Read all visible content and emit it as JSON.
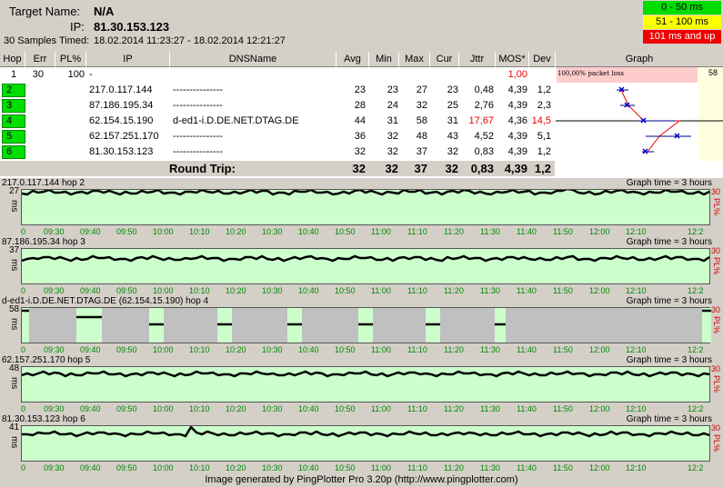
{
  "header": {
    "target_label": "Target Name:",
    "target_value": "N/A",
    "ip_label": "IP:",
    "ip_value": "81.30.153.123",
    "samples_label": "30 Samples Timed:",
    "samples_value": "18.02.2014 11:23:27 - 18.02.2014 12:21:27"
  },
  "legend": [
    {
      "label": "0 - 50 ms",
      "color": "#00dd00",
      "text_color": "#000000"
    },
    {
      "label": "51 - 100 ms",
      "color": "#ffff00",
      "text_color": "#000000"
    },
    {
      "label": "101 ms and up",
      "color": "#ee0000",
      "text_color": "#ffffff"
    }
  ],
  "columns": [
    "Hop",
    "Err",
    "PL%",
    "IP",
    "DNSName",
    "Avg",
    "Min",
    "Max",
    "Cur",
    "Jttr",
    "MOS*",
    "Dev",
    "Graph"
  ],
  "rows": [
    {
      "hop": "1",
      "err": "30",
      "pl": "100",
      "ip": "-",
      "dns": "",
      "avg": "",
      "min": "",
      "max": "",
      "cur": "",
      "jttr": "",
      "mos": "1,00",
      "dev": ""
    },
    {
      "hop": "2",
      "err": "",
      "pl": "",
      "ip": "217.0.117.144",
      "dns": "---------------",
      "avg": "23",
      "min": "23",
      "max": "27",
      "cur": "23",
      "jttr": "0,48",
      "mos": "4,39",
      "dev": "1,2"
    },
    {
      "hop": "3",
      "err": "",
      "pl": "",
      "ip": "87.186.195.34",
      "dns": "---------------",
      "avg": "28",
      "min": "24",
      "max": "32",
      "cur": "25",
      "jttr": "2,76",
      "mos": "4,39",
      "dev": "2,3"
    },
    {
      "hop": "4",
      "err": "",
      "pl": "",
      "ip": "62.154.15.190",
      "dns": "d-ed1-i.D.DE.NET.DTAG.DE",
      "avg": "44",
      "min": "31",
      "max": "58",
      "cur": "31",
      "jttr": "17,67",
      "mos": "4,36",
      "dev": "14,5"
    },
    {
      "hop": "5",
      "err": "",
      "pl": "",
      "ip": "62.157.251.170",
      "dns": "---------------",
      "avg": "36",
      "min": "32",
      "max": "48",
      "cur": "43",
      "jttr": "4,52",
      "mos": "4,39",
      "dev": "5,1"
    },
    {
      "hop": "6",
      "err": "",
      "pl": "",
      "ip": "81.30.153.123",
      "dns": "---------------",
      "avg": "32",
      "min": "32",
      "max": "37",
      "cur": "32",
      "jttr": "0,83",
      "mos": "4,39",
      "dev": "1,2"
    }
  ],
  "round_trip": {
    "label": "Round Trip:",
    "avg": "32",
    "min": "32",
    "max": "37",
    "cur": "32",
    "jttr": "0,83",
    "mos": "4,39",
    "dev": "1,2"
  },
  "graph_header": {
    "pl_label": "100,00% packet loss",
    "scale_max": "58"
  },
  "graphs": [
    {
      "title": "217.0.117.144 hop 2",
      "time": "Graph time = 3 hours",
      "ymax": "27",
      "ms": "ms",
      "pl_top": "30",
      "pl_label": "PL%"
    },
    {
      "title": "87.186.195.34 hop 3",
      "time": "Graph time = 3 hours",
      "ymax": "37",
      "ms": "ms",
      "pl_top": "30",
      "pl_label": "PL%"
    },
    {
      "title": "d-ed1-i.D.DE.NET.DTAG.DE (62.154.15.190) hop 4",
      "time": "Graph time = 3 hours",
      "ymax": "58",
      "ms": "ms",
      "pl_top": "30",
      "pl_label": "PL%"
    },
    {
      "title": "62.157.251.170 hop 5",
      "time": "Graph time = 3 hours",
      "ymax": "48",
      "ms": "ms",
      "pl_top": "30",
      "pl_label": "PL%"
    },
    {
      "title": "81.30.153.123 hop 6",
      "time": "Graph time = 3 hours",
      "ymax": "41",
      "ms": "ms",
      "pl_top": "30",
      "pl_label": "PL%"
    }
  ],
  "x_ticks": [
    "0",
    "09:30",
    "09:40",
    "09:50",
    "10:00",
    "10:10",
    "10:20",
    "10:30",
    "10:40",
    "10:50",
    "11:00",
    "11:10",
    "11:20",
    "11:30",
    "11:40",
    "11:50",
    "12:00",
    "12:10",
    "12:2"
  ],
  "footer": "Image generated by PingPlotter Pro 3.20p (http://www.pingplotter.com)"
}
